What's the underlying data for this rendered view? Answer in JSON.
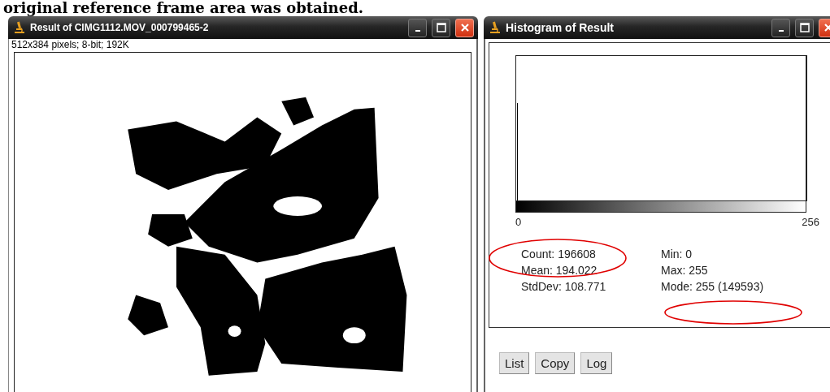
{
  "header_text": "original reference frame area was obtained.",
  "image_window": {
    "title": "Result of CIMG1112.MOV_000799465-2",
    "info": "512x384 pixels; 8-bit; 192K"
  },
  "histogram_window": {
    "title": "Histogram of Result",
    "axis_min": "0",
    "axis_max": "256",
    "stats_left": [
      "Count: 196608",
      "Mean: 194.022",
      "StdDev: 108.771"
    ],
    "stats_right": [
      "Min: 0",
      "Max: 255",
      "Mode: 255 (149593)"
    ],
    "buttons": [
      "List",
      "Copy",
      "Log"
    ]
  }
}
